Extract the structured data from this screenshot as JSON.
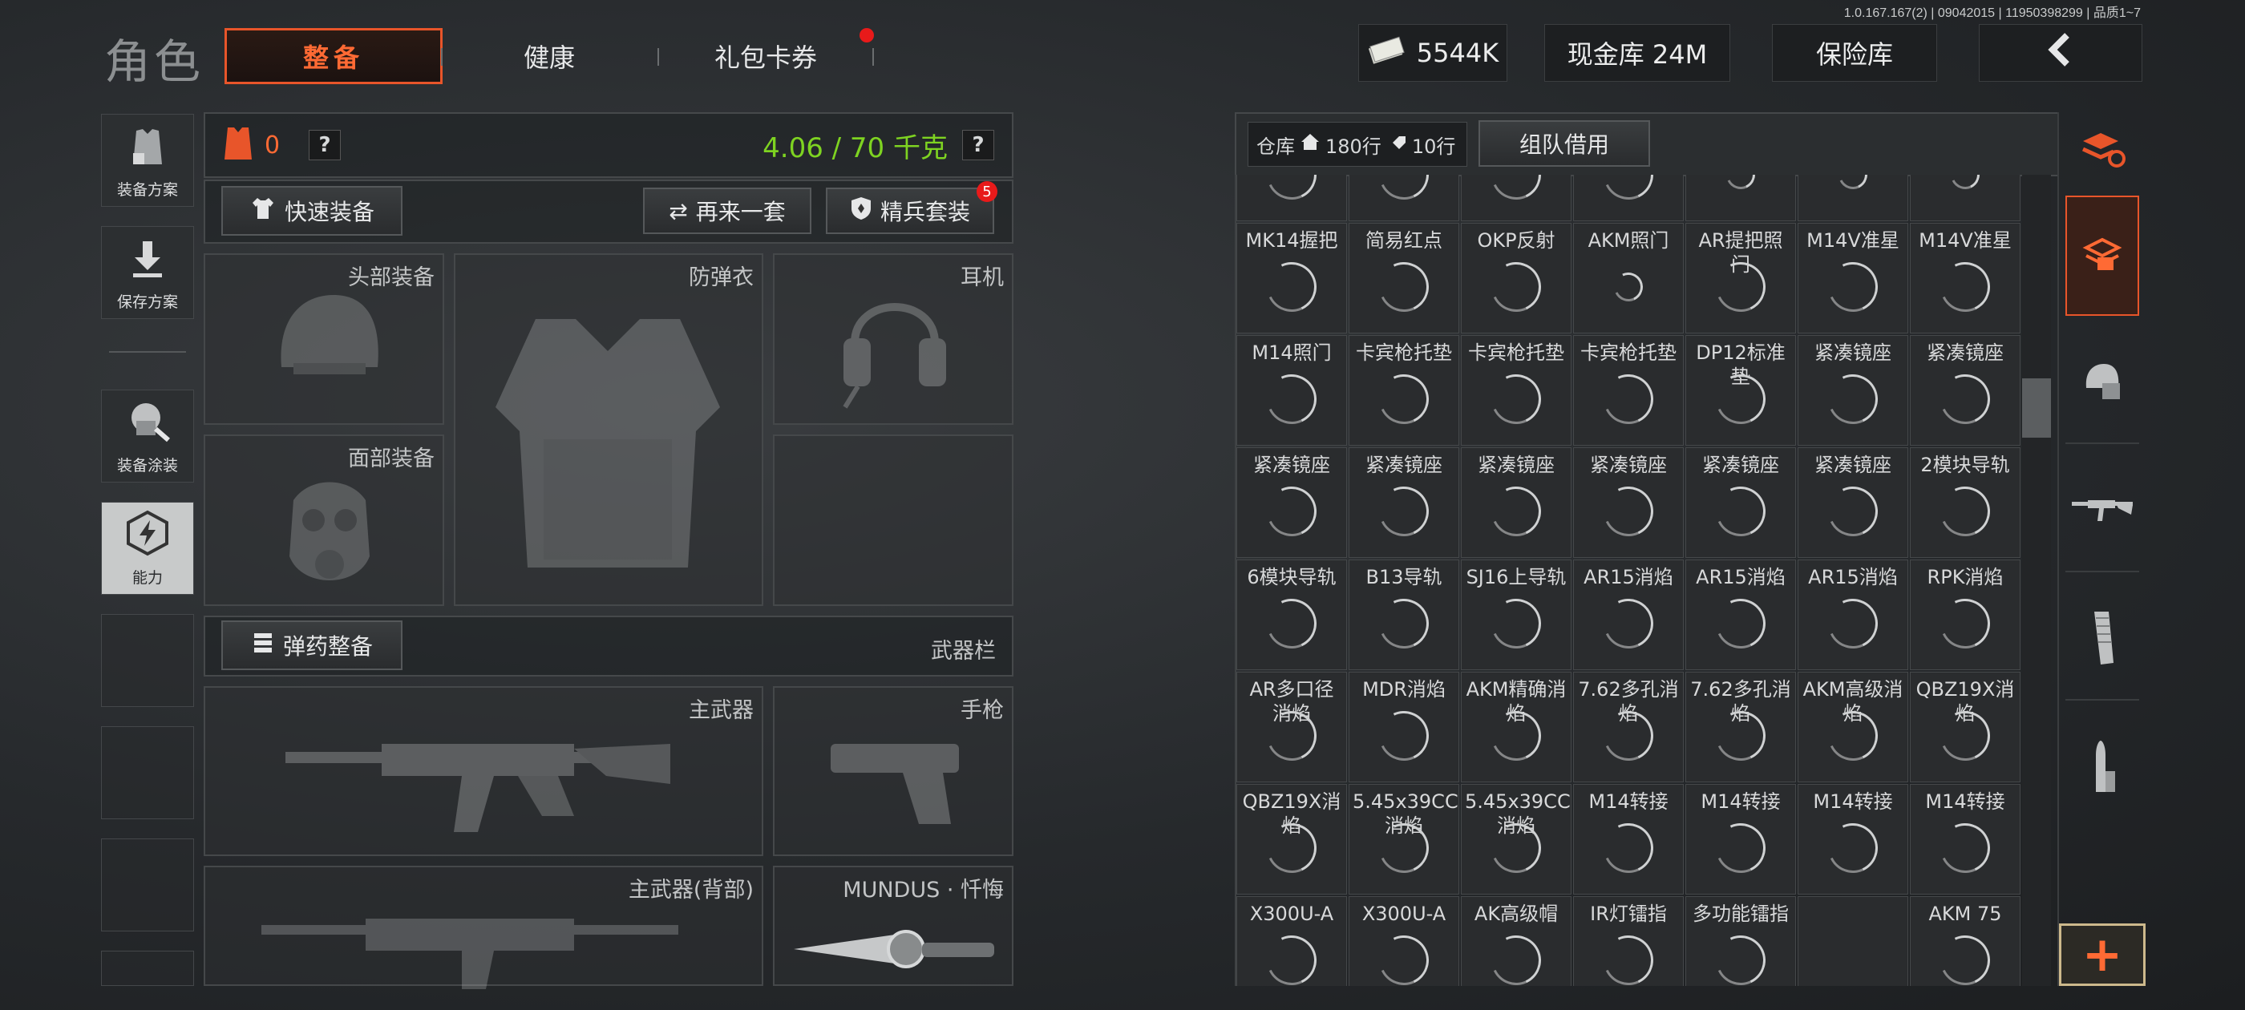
{
  "version": "1.0.167.167(2) | 09042015 | 11950398299 | 品质1~7",
  "header": {
    "title": "角色",
    "tabs": [
      {
        "label": "整备",
        "active": true
      },
      {
        "label": "健康",
        "active": false
      },
      {
        "label": "礼包卡券",
        "active": false
      }
    ],
    "cash_value": "5544K",
    "vault_label": "现金库 24M",
    "safe_label": "保险库",
    "back_icon": "chevron-left-icon"
  },
  "sidebar": {
    "items": [
      {
        "label": "装备方案",
        "icon": "vest-plan-icon"
      },
      {
        "label": "保存方案",
        "icon": "download-icon"
      },
      {
        "label": "装备涂装",
        "icon": "paint-icon"
      },
      {
        "label": "能力",
        "icon": "lightning-hex-icon"
      }
    ]
  },
  "loadout": {
    "armor_value": "0",
    "help_icon": "?",
    "weight": "4.06 / 70 千克",
    "quick_equip": "快速装备",
    "again_set": "再来一套",
    "elite_set": "精兵套装",
    "elite_badge": "5",
    "slots": {
      "head": "头部装备",
      "vest": "防弹衣",
      "headset": "耳机",
      "face": "面部装备"
    },
    "ammo_equip": "弹药整备",
    "weapon_bar": "武器栏",
    "primary": "主武器",
    "pistol": "手枪",
    "primary_back": "主武器(背部)",
    "melee": "MUNDUS · 忏悔"
  },
  "warehouse": {
    "label": "仓库",
    "rows": "180行",
    "rows2": "10行",
    "team_borrow": "组队借用",
    "items": [
      [
        "",
        "",
        "",
        "",
        "",
        "",
        ""
      ],
      [
        "MK14握把",
        "简易红点",
        "OKP反射",
        "AKM照门",
        "AR提把照门",
        "M14V准星",
        "M14V准星"
      ],
      [
        "M14照门",
        "卡宾枪托垫",
        "卡宾枪托垫",
        "卡宾枪托垫",
        "DP12标准垫",
        "紧凑镜座",
        "紧凑镜座"
      ],
      [
        "紧凑镜座",
        "紧凑镜座",
        "紧凑镜座",
        "紧凑镜座",
        "紧凑镜座",
        "紧凑镜座",
        "2模块导轨"
      ],
      [
        "6模块导轨",
        "B13导轨",
        "SJ16上导轨",
        "AR15消焰",
        "AR15消焰",
        "AR15消焰",
        "RPK消焰"
      ],
      [
        "AR多口径消焰",
        "MDR消焰",
        "AKM精确消焰",
        "7.62多孔消焰",
        "7.62多孔消焰",
        "AKM高级消焰",
        "QBZ19X消焰"
      ],
      [
        "QBZ19X消焰",
        "5.45x39CC消焰",
        "5.45x39CC消焰",
        "M14转接",
        "M14转接",
        "M14转接",
        "M14转接"
      ],
      [
        "X300U-A",
        "X300U-A",
        "AK高级帽",
        "IR灯镭指",
        "多功能镭指",
        "",
        "AKM 75"
      ]
    ]
  },
  "colors": {
    "accent": "#e8552a",
    "weight_green": "#7ed321",
    "badge_red": "#e81a1a"
  }
}
